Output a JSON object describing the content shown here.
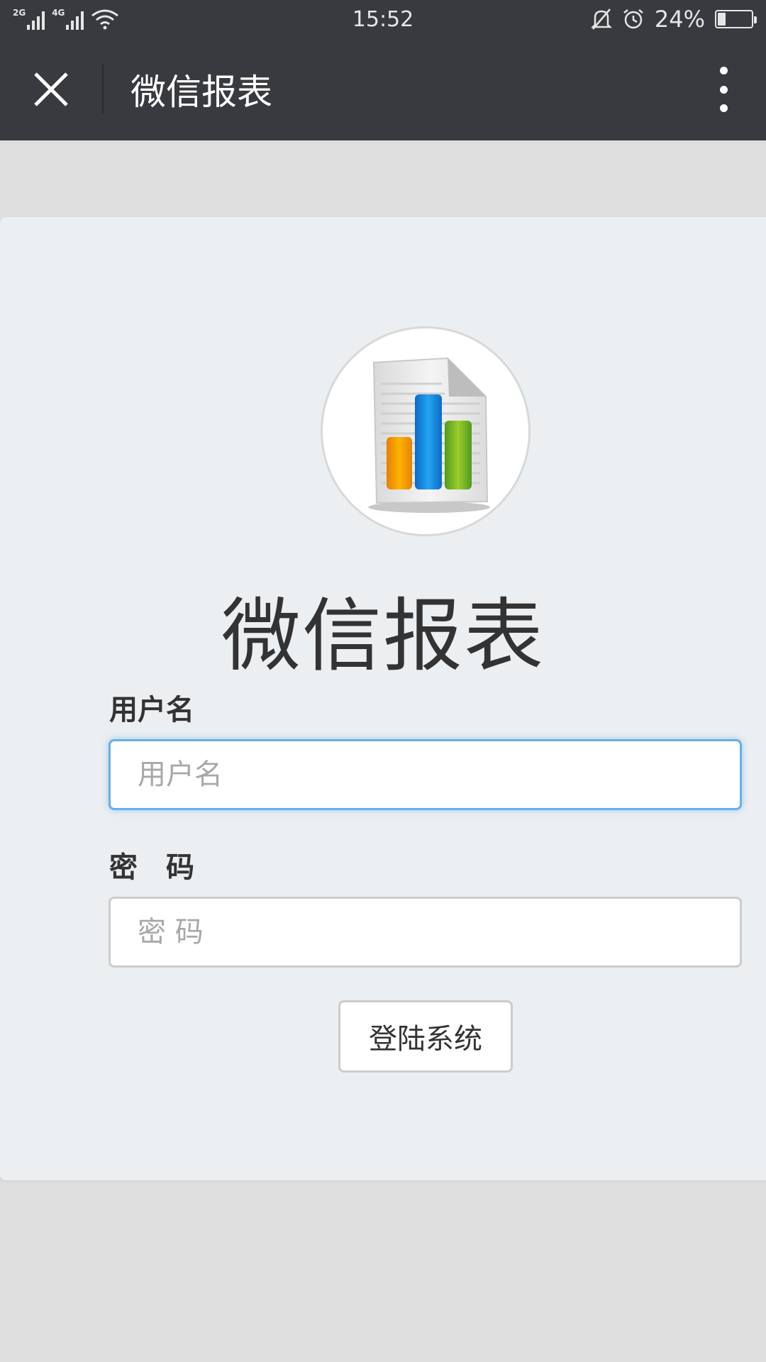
{
  "status_bar": {
    "time": "15:52",
    "network_1": "2G",
    "network_2": "4G",
    "battery_text": "24%",
    "battery_level": 0.24,
    "icons": [
      "signal-icon",
      "wifi-icon",
      "bell-muted-icon",
      "alarm-icon",
      "battery-icon"
    ]
  },
  "title_bar": {
    "title": "微信报表",
    "icons": [
      "close-icon",
      "more-icon"
    ]
  },
  "login": {
    "app_title": "微信报表",
    "username_label": "用户名",
    "username_placeholder": "用户名",
    "username_value": "",
    "password_label": "密　码",
    "password_placeholder": "密 码",
    "password_value": "",
    "submit_label": "登陆系统"
  },
  "colors": {
    "header_bg": "#393a3f",
    "page_bg": "#dedede",
    "card_bg": "#ebeff1",
    "focus_border": "#66afe9",
    "bar_orange": "#f39c12",
    "bar_blue": "#1e88e5",
    "bar_green": "#7cb82f"
  }
}
